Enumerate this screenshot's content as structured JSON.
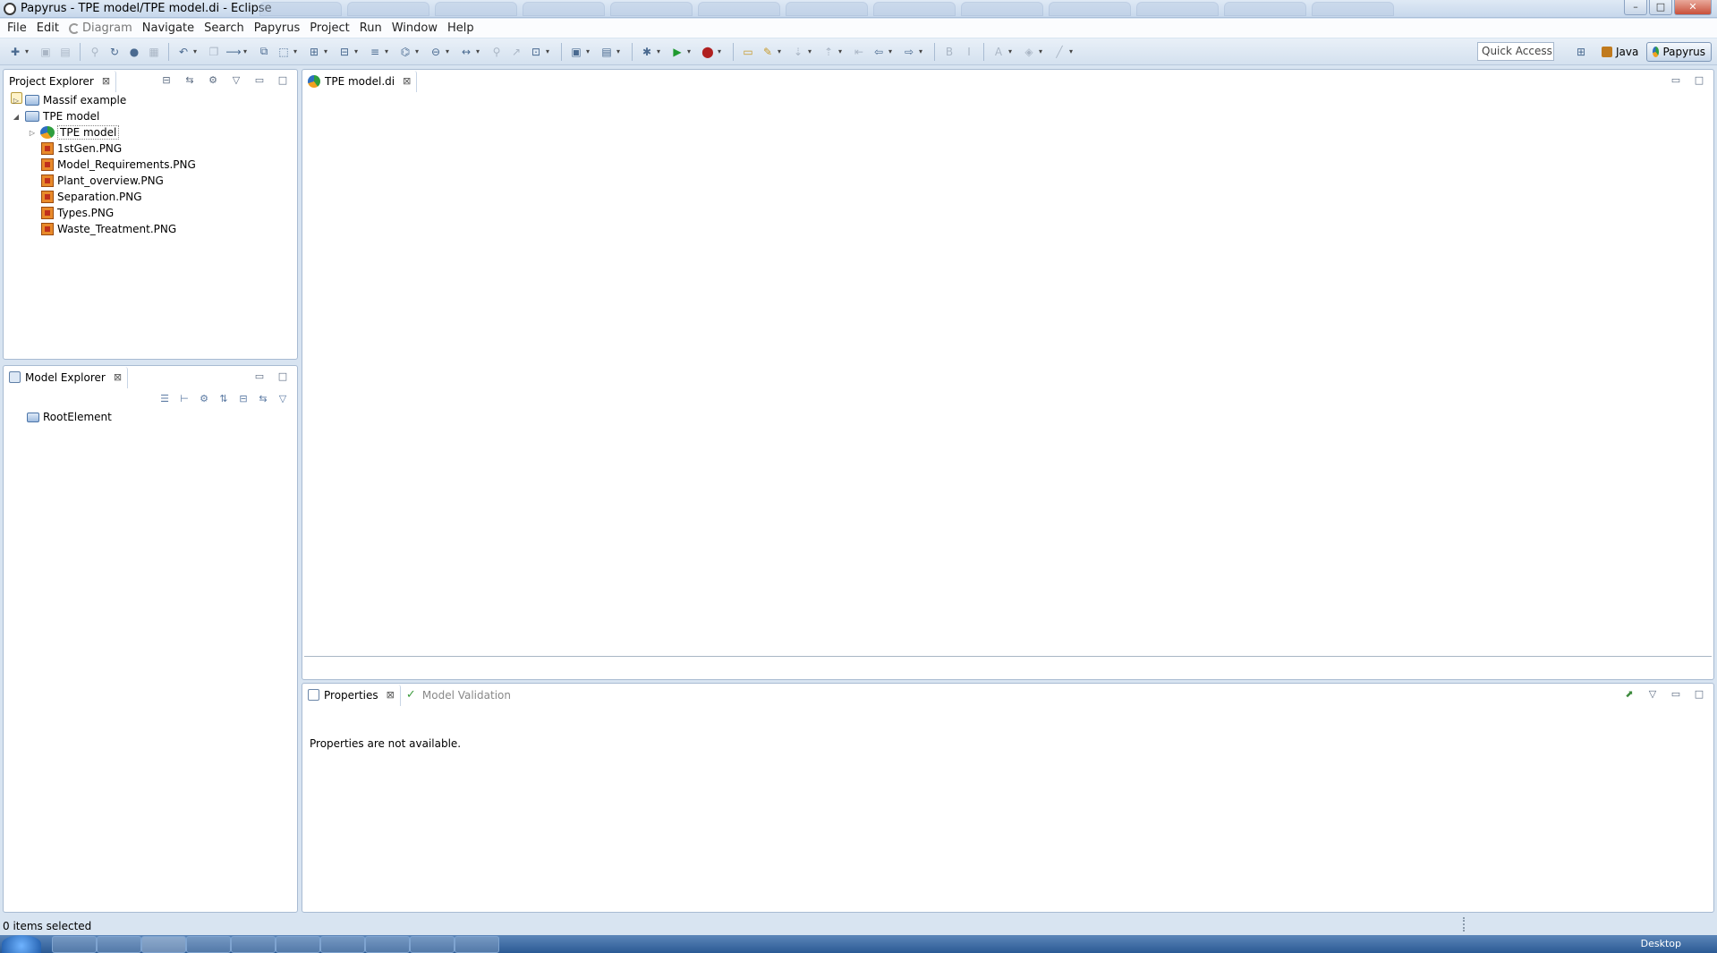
{
  "window": {
    "title": "Papyrus - TPE model/TPE model.di - Eclipse",
    "controls": [
      "–",
      "□",
      "✕"
    ]
  },
  "menubar": {
    "items": [
      {
        "label": "File",
        "disabled": false
      },
      {
        "label": "Edit",
        "disabled": false
      },
      {
        "label": "Diagram",
        "disabled": true
      },
      {
        "label": "Navigate",
        "disabled": false
      },
      {
        "label": "Search",
        "disabled": false
      },
      {
        "label": "Papyrus",
        "disabled": false
      },
      {
        "label": "Project",
        "disabled": false
      },
      {
        "label": "Run",
        "disabled": false
      },
      {
        "label": "Window",
        "disabled": false
      },
      {
        "label": "Help",
        "disabled": false
      }
    ]
  },
  "toolbar": {
    "quick_access": "Quick Access",
    "perspectives": {
      "java": "Java",
      "papyrus": "Papyrus"
    }
  },
  "project_explorer": {
    "title": "Project Explorer",
    "tree": [
      {
        "label": "Massif example",
        "type": "project",
        "twisty": "▷",
        "depth": 0
      },
      {
        "label": "TPE model",
        "type": "project",
        "twisty": "◢",
        "depth": 0
      },
      {
        "label": "TPE model",
        "type": "papyrus",
        "twisty": "▷",
        "depth": 1,
        "selected": true
      },
      {
        "label": "1stGen.PNG",
        "type": "png",
        "twisty": "",
        "depth": 1
      },
      {
        "label": "Model_Requirements.PNG",
        "type": "png",
        "twisty": "",
        "depth": 1
      },
      {
        "label": "Plant_overview.PNG",
        "type": "png",
        "twisty": "",
        "depth": 1
      },
      {
        "label": "Separation.PNG",
        "type": "png",
        "twisty": "",
        "depth": 1
      },
      {
        "label": "Types.PNG",
        "type": "png",
        "twisty": "",
        "depth": 1
      },
      {
        "label": "Waste_Treatment.PNG",
        "type": "png",
        "twisty": "",
        "depth": 1
      }
    ]
  },
  "model_explorer": {
    "title": "Model Explorer",
    "tree": [
      {
        "label": "RootElement",
        "type": "folder"
      }
    ]
  },
  "editor": {
    "tab": "TPE model.di"
  },
  "properties": {
    "tab": "Properties",
    "tab2": "Model Validation",
    "message": "Properties are not available."
  },
  "status": {
    "text": "0 items selected"
  },
  "taskbar": {
    "tray_text": "Desktop"
  }
}
